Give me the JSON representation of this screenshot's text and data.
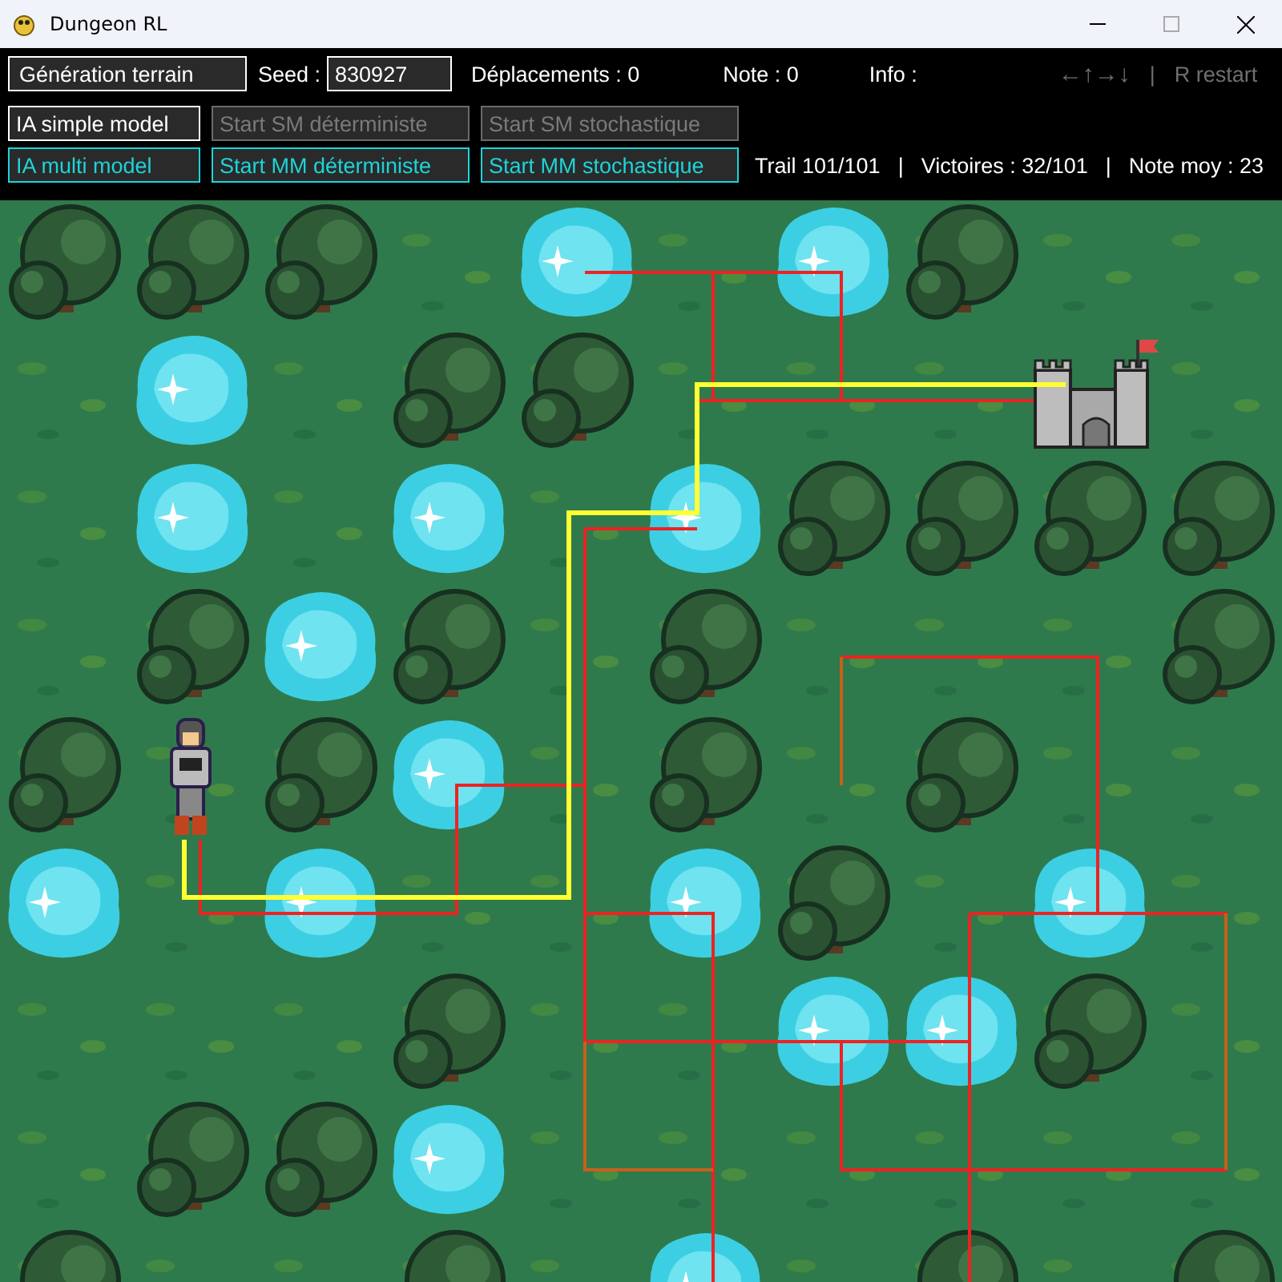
{
  "window": {
    "title": "Dungeon RL"
  },
  "toolbar": {
    "generate_button": "Génération terrain",
    "seed_label": "Seed :",
    "seed_value": "830927",
    "moves": "Déplacements : 0",
    "score": "Note : 0",
    "info": "Info :",
    "keys_hint": "←↑→↓",
    "separator": "|",
    "restart_hint": "R restart"
  },
  "model_rows": [
    {
      "mode": {
        "label": "IA simple model",
        "selected": false
      },
      "starts": [
        {
          "label": "Start SM déterministe",
          "disabled": true
        },
        {
          "label": "Start SM stochastique",
          "disabled": true
        }
      ]
    },
    {
      "mode": {
        "label": "IA multi model",
        "selected": true
      },
      "starts": [
        {
          "label": "Start MM déterministe",
          "disabled": false
        },
        {
          "label": "Start MM stochastique",
          "disabled": false
        }
      ]
    }
  ],
  "stats": [
    "Trail 101/101",
    "|",
    "Victoires : 32/101",
    "|",
    "Note moy : 23"
  ]
}
